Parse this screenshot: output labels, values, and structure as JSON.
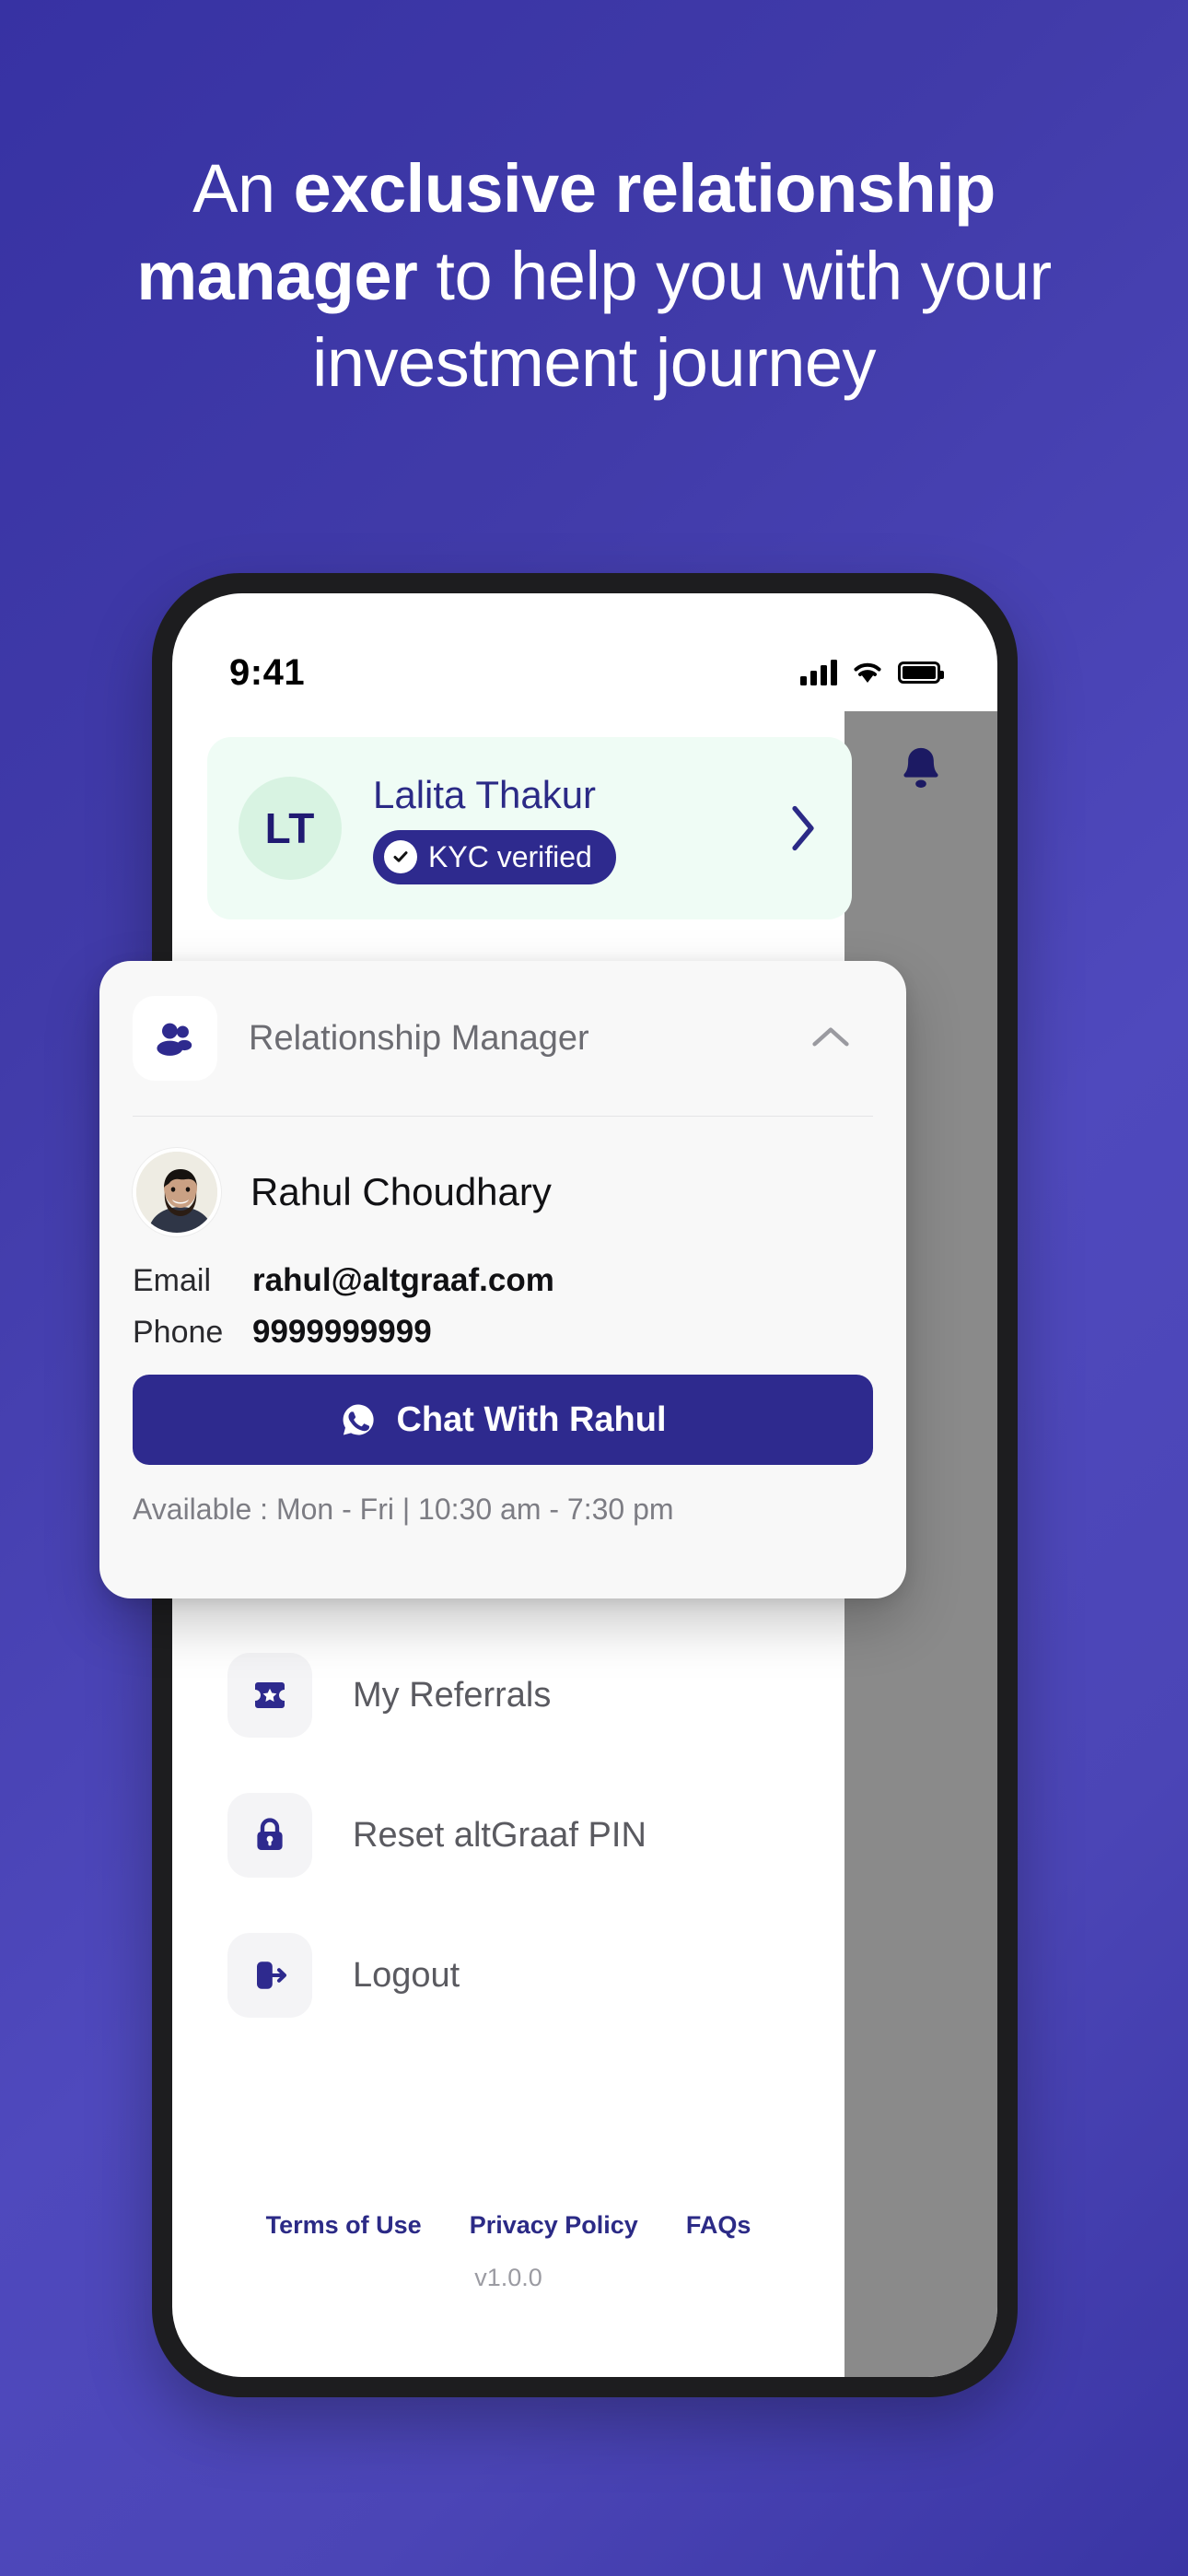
{
  "promo": {
    "headline_parts": [
      {
        "text": "An ",
        "bold": false
      },
      {
        "text": "exclusive relationship manager",
        "bold": true
      },
      {
        "text": " to help you with your investment journey",
        "bold": false
      }
    ],
    "headline_plain": "An exclusive relationship manager to help you with your investment journey"
  },
  "colors": {
    "bg_gradient_from": "#3732a3",
    "bg_gradient_to": "#4f49bd",
    "brand_indigo": "#2e2a8e",
    "profile_card_bg": "#effcf5",
    "dim_overlay": "#8a8a8a"
  },
  "status_bar": {
    "time": "9:41",
    "signal_icon": "cellular-signal-icon",
    "wifi_icon": "wifi-icon",
    "battery_icon": "battery-full-icon"
  },
  "top_bar": {
    "notification_icon": "bell-icon"
  },
  "profile": {
    "initials": "LT",
    "name": "Lalita Thakur",
    "kyc_badge": "KYC verified",
    "kyc_icon": "check-circle-icon",
    "chevron_icon": "chevron-right-icon"
  },
  "relationship_manager": {
    "section_title": "Relationship Manager",
    "section_icon": "users-group-icon",
    "collapse_icon": "chevron-up-icon",
    "person_name": "Rahul Choudhary",
    "person_photo": "avatar-photo",
    "email_label": "Email",
    "email_value": "rahul@altgraaf.com",
    "phone_label": "Phone",
    "phone_value": "9999999999",
    "chat_button_label": "Chat With Rahul",
    "chat_button_icon": "whatsapp-icon",
    "availability": "Available : Mon - Fri | 10:30 am - 7:30 pm"
  },
  "menu": {
    "items": [
      {
        "label": "My Referrals",
        "icon": "ticket-star-icon"
      },
      {
        "label": "Reset altGraaf PIN",
        "icon": "lock-icon"
      },
      {
        "label": "Logout",
        "icon": "logout-arrow-icon"
      }
    ]
  },
  "footer": {
    "links": [
      "Terms of Use",
      "Privacy Policy",
      "FAQs"
    ],
    "version": "v1.0.0"
  }
}
